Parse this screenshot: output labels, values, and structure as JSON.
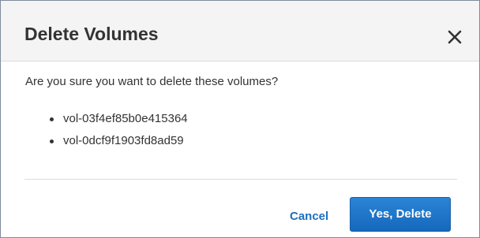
{
  "dialog": {
    "title": "Delete Volumes",
    "close_icon": "close-icon",
    "question": "Are you sure you want to delete these volumes?",
    "volumes": [
      "vol-03f4ef85b0e415364",
      "vol-0dcf9f1903fd8ad59"
    ],
    "cancel_label": "Cancel",
    "confirm_label": "Yes, Delete"
  },
  "colors": {
    "primary_button": "#1f77c9",
    "link": "#1e6fbf",
    "header_bg": "#f4f4f4",
    "text": "#333333"
  }
}
